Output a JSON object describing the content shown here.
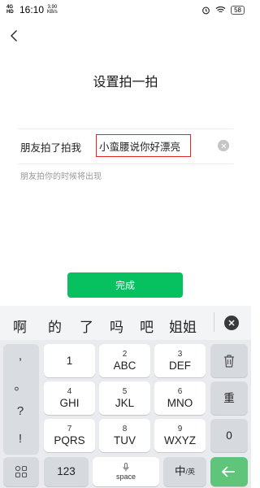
{
  "status_bar": {
    "network": "4G HD",
    "time": "16:10",
    "speed_value": "3.90",
    "speed_unit": "KB/s",
    "battery": "58"
  },
  "page": {
    "title": "设置拍一拍",
    "field_label": "朋友拍了拍我",
    "field_value": "小蛮腰说你好漂亮",
    "hint": "朋友拍你的时候将出现",
    "done_label": "完成"
  },
  "keyboard": {
    "candidates": [
      "啊",
      "的",
      "了",
      "吗",
      "吧",
      "姐姐"
    ],
    "punct_keys": [
      ",",
      "。",
      "?",
      "!"
    ],
    "keys": [
      {
        "num": "",
        "letters": "1"
      },
      {
        "num": "2",
        "letters": "ABC"
      },
      {
        "num": "3",
        "letters": "DEF"
      },
      {
        "num": "4",
        "letters": "GHI"
      },
      {
        "num": "5",
        "letters": "JKL"
      },
      {
        "num": "6",
        "letters": "MNO"
      },
      {
        "num": "7",
        "letters": "PQRS"
      },
      {
        "num": "8",
        "letters": "TUV"
      },
      {
        "num": "9",
        "letters": "WXYZ"
      }
    ],
    "reenter_label": "重",
    "zero_label": "0",
    "num_label": "123",
    "space_label": "space",
    "lang_main": "中",
    "lang_sub": "/英"
  },
  "colors": {
    "accent": "#07c160",
    "highlight_border": "#e02828"
  }
}
